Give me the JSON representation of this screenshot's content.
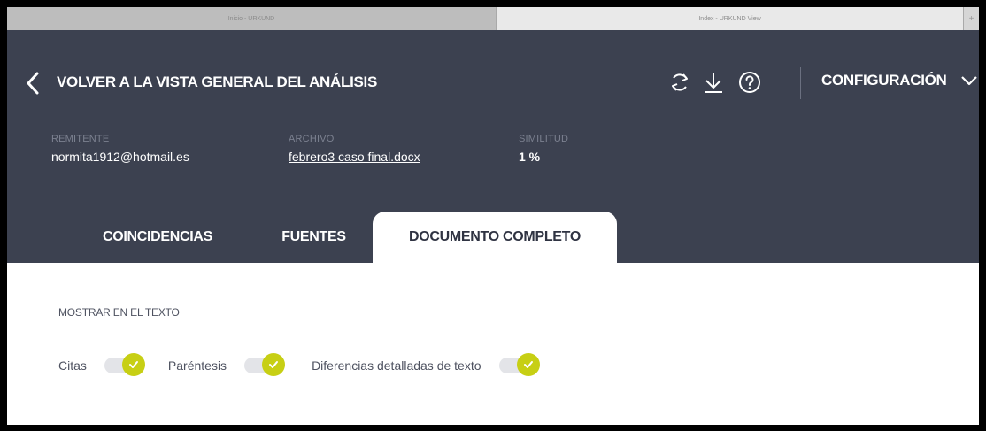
{
  "browser": {
    "tabs": [
      {
        "title": "Inicio - URKUND"
      },
      {
        "title": "Index - URKUND View"
      }
    ],
    "new_tab_symbol": "+"
  },
  "header": {
    "back_label": "VOLVER A LA VISTA GENERAL DEL ANÁLISIS",
    "icons": [
      "chevron-left-icon",
      "refresh-icon",
      "download-icon",
      "help-icon",
      "chevron-down-icon"
    ],
    "config_label": "CONFIGURACIÓN",
    "colors": {
      "background": "#3c4150",
      "accent": "#c7cf14"
    }
  },
  "meta": {
    "sender_label": "REMITENTE",
    "sender_value": "normita1912@hotmail.es",
    "file_label": "ARCHIVO",
    "file_value": "febrero3 caso final.docx",
    "similarity_label": "SIMILITUD",
    "similarity_value": "1 %"
  },
  "tabs": [
    {
      "label": "COINCIDENCIAS",
      "active": false
    },
    {
      "label": "FUENTES",
      "active": false
    },
    {
      "label": "DOCUMENTO COMPLETO",
      "active": true
    }
  ],
  "content": {
    "section_label": "MOSTRAR EN EL TEXTO",
    "toggles": [
      {
        "label": "Citas",
        "checked": true
      },
      {
        "label": "Paréntesis",
        "checked": true
      },
      {
        "label": "Diferencias detalladas de texto",
        "checked": true
      }
    ]
  }
}
